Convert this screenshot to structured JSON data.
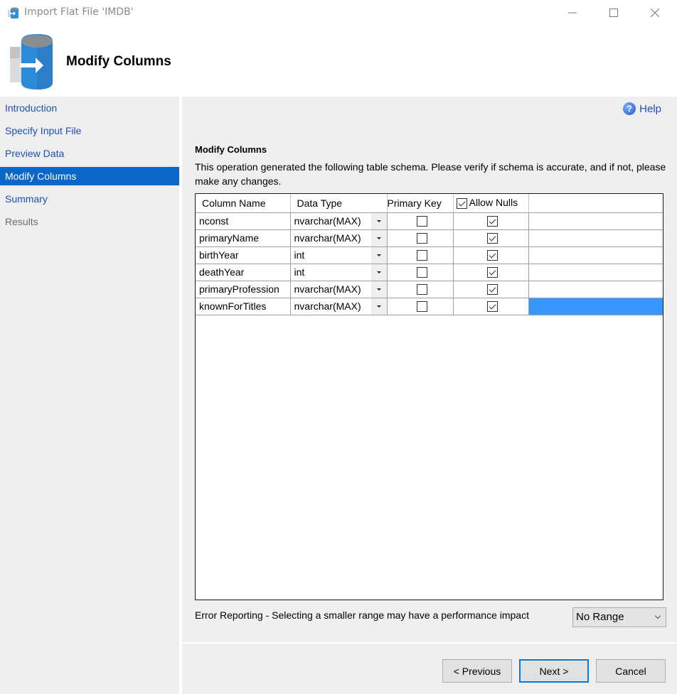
{
  "window": {
    "title": "Import Flat File 'IMDB'",
    "controls": [
      "minimize",
      "maximize",
      "close"
    ]
  },
  "header": {
    "title": "Modify Columns",
    "icon": "database-import-icon"
  },
  "sidebar": {
    "items": [
      {
        "label": "Introduction",
        "state": "link"
      },
      {
        "label": "Specify Input File",
        "state": "link"
      },
      {
        "label": "Preview Data",
        "state": "link"
      },
      {
        "label": "Modify Columns",
        "state": "active"
      },
      {
        "label": "Summary",
        "state": "link"
      },
      {
        "label": "Results",
        "state": "disabled"
      }
    ]
  },
  "main": {
    "help_label": "Help",
    "section_title": "Modify Columns",
    "description": "This operation generated the following table schema. Please verify if schema is accurate, and if not, please make any changes.",
    "grid": {
      "columns": [
        "Column Name",
        "Data Type",
        "Primary Key",
        "Allow Nulls"
      ],
      "allow_nulls_header_checked": true,
      "rows": [
        {
          "name": "nconst",
          "type": "nvarchar(MAX)",
          "primary_key": false,
          "allow_nulls": true
        },
        {
          "name": "primaryName",
          "type": "nvarchar(MAX)",
          "primary_key": false,
          "allow_nulls": true
        },
        {
          "name": "birthYear",
          "type": "int",
          "primary_key": false,
          "allow_nulls": true
        },
        {
          "name": "deathYear",
          "type": "int",
          "primary_key": false,
          "allow_nulls": true
        },
        {
          "name": "primaryProfession",
          "type": "nvarchar(MAX)",
          "primary_key": false,
          "allow_nulls": true
        },
        {
          "name": "knownForTitles",
          "type": "nvarchar(MAX)",
          "primary_key": false,
          "allow_nulls": true
        }
      ],
      "selected_row": 5
    },
    "error_reporting": {
      "label": "Error Reporting - Selecting a smaller range may have a performance impact",
      "selected": "No Range"
    }
  },
  "footer": {
    "previous": "< Previous",
    "next": "Next >",
    "cancel": "Cancel"
  },
  "colors": {
    "accent": "#0a66c7",
    "selection": "#3797fd",
    "link": "#1f4fb4",
    "panel_bg": "#efefef"
  }
}
